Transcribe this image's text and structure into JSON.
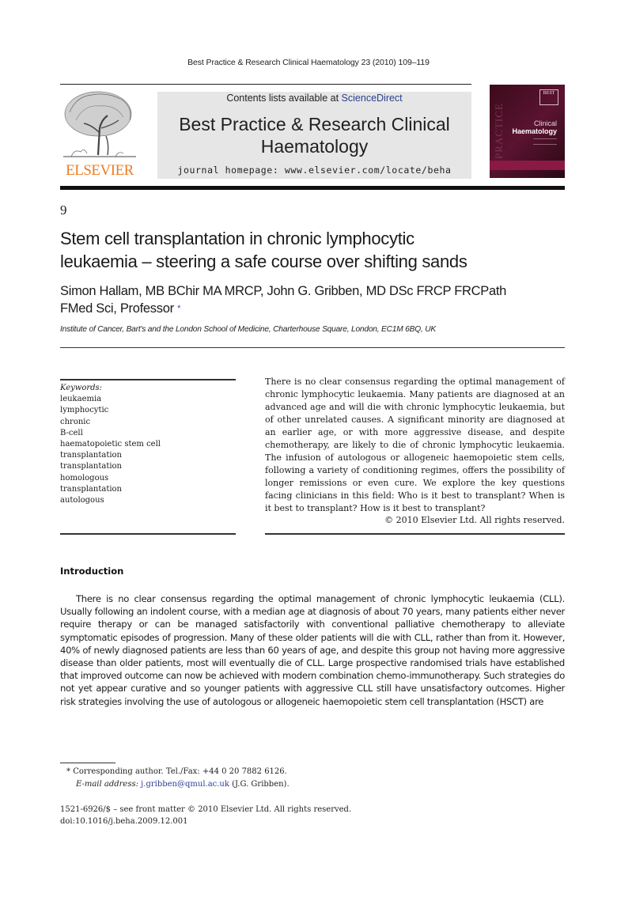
{
  "running_head": "Best Practice & Research Clinical Haematology 23 (2010) 109–119",
  "masthead": {
    "publisher_logo": "elsevier-tree-logo",
    "publisher_name": "ELSEVIER",
    "contents_prefix": "Contents lists available at",
    "contents_link": "ScienceDirect",
    "journal_title_line1": "Best Practice & Research Clinical",
    "journal_title_line2": "Haematology",
    "homepage": "journal homepage: www.elsevier.com/locate/beha",
    "cover": {
      "series_badge": "BEST",
      "spine_text": "PRACTICE",
      "subtitle": "Clinical",
      "title": "Haematology"
    }
  },
  "article": {
    "chapter_number": "9",
    "title_line1": "Stem cell transplantation in chronic lymphocytic",
    "title_line2": "leukaemia – steering a safe course over shifting sands",
    "authors_line1": "Simon Hallam, MB BChir MA MRCP, John G. Gribben, MD DSc FRCP FRCPath",
    "authors_line2": "FMed Sci, Professor",
    "corresponding_marker": "*",
    "affiliation": "Institute of Cancer, Bart's and the London School of Medicine, Charterhouse Square, London, EC1M 6BQ, UK"
  },
  "keywords": {
    "label": "Keywords:",
    "items": [
      "leukaemia",
      "lymphocytic",
      "chronic",
      "B-cell",
      "haematopoietic stem cell",
      "transplantation",
      "transplantation",
      "homologous",
      "transplantation",
      "autologous"
    ]
  },
  "abstract": {
    "text": "There is no clear consensus regarding the optimal management of chronic lymphocytic leukaemia. Many patients are diagnosed at an advanced age and will die with chronic lymphocytic leukaemia, but of other unrelated causes. A significant minority are diagnosed at an earlier age, or with more aggressive disease, and despite chemotherapy, are likely to die of chronic lymphocytic leukaemia. The infusion of autologous or allogeneic haemopoietic stem cells, following a variety of conditioning regimes, offers the possibility of longer remissions or even cure. We explore the key questions facing clinicians in this field: Who is it best to transplant? When is it best to transplant? How is it best to transplant?",
    "copyright": "© 2010 Elsevier Ltd. All rights reserved."
  },
  "introduction": {
    "heading": "Introduction",
    "paragraph": "There is no clear consensus regarding the optimal management of chronic lymphocytic leukaemia (CLL). Usually following an indolent course, with a median age at diagnosis of about 70 years, many patients either never require therapy or can be managed satisfactorily with conventional palliative chemotherapy to alleviate symptomatic episodes of progression. Many of these older patients will die with CLL, rather than from it. However, 40% of newly diagnosed patients are less than 60 years of age, and despite this group not having more aggressive disease than older patients, most will eventually die of CLL. Large prospective randomised trials have established that improved outcome can now be achieved with modern combination chemo-immunotherapy. Such strategies do not yet appear curative and so younger patients with aggressive CLL still have unsatisfactory outcomes. Higher risk strategies involving the use of autologous or allogeneic haemopoietic stem cell transplantation (HSCT) are"
  },
  "footnote": {
    "marker": "*",
    "corresponding": "Corresponding author. Tel./Fax: +44 0 20 7882 6126.",
    "email_label": "E-mail address:",
    "email": "j.gribben@qmul.ac.uk",
    "email_suffix": "(J.G. Gribben)."
  },
  "front_matter": {
    "issn": "1521-6926/$ – see front matter © 2010 Elsevier Ltd. All rights reserved.",
    "doi": "doi:10.1016/j.beha.2009.12.001"
  },
  "colors": {
    "elsevier_orange": "#f07b1f",
    "link_blue": "#2a3f8f",
    "cover_maroon": "#5a1330",
    "banner_gray": "#e6e6e6"
  }
}
